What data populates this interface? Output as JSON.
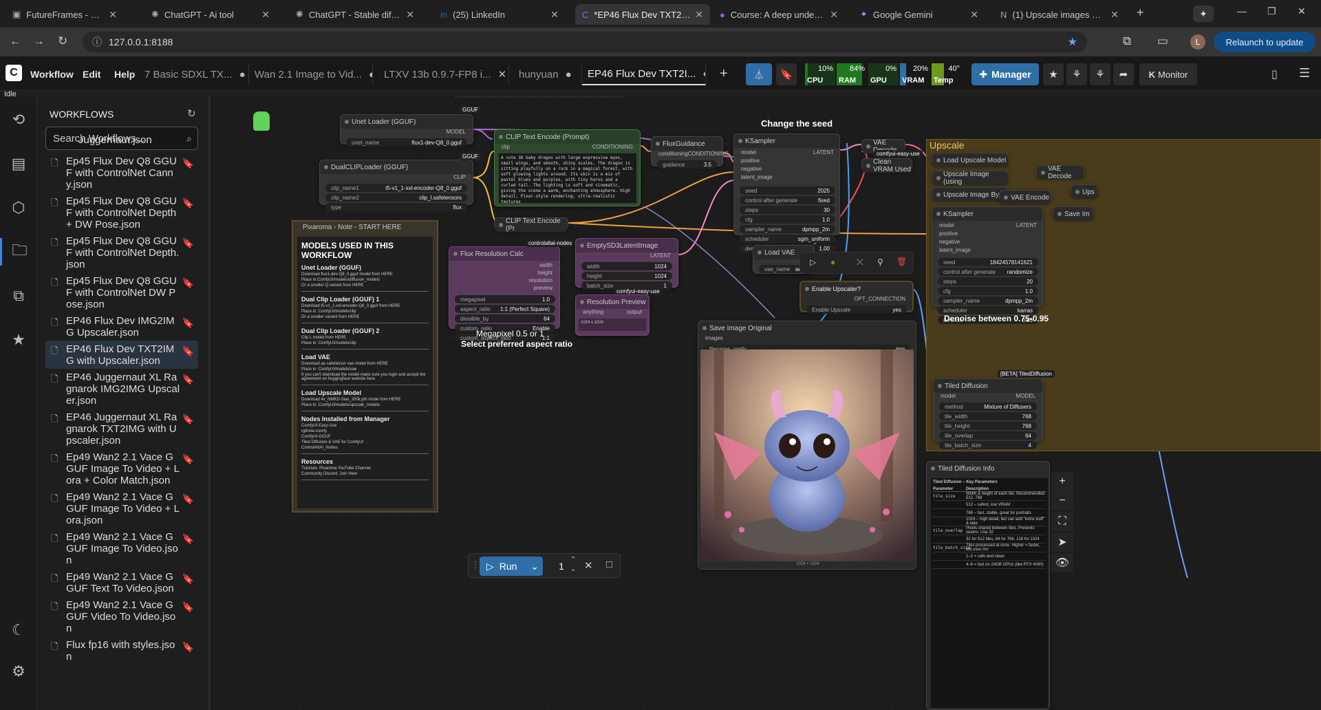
{
  "browser": {
    "tabs": [
      {
        "label": "FutureFrames - Free Wee",
        "icon": "futureframes-icon"
      },
      {
        "label": "ChatGPT - Ai tool",
        "icon": "chatgpt-icon"
      },
      {
        "label": "ChatGPT - Stable diffusio",
        "icon": "chatgpt-icon"
      },
      {
        "label": "(25) LinkedIn",
        "icon": "linkedin-icon"
      },
      {
        "label": "*EP46 Flux Dev TXT2IMG",
        "icon": "comfy-icon"
      },
      {
        "label": "Course: A deep understa",
        "icon": "course-icon"
      },
      {
        "label": "Google Gemini",
        "icon": "gemini-icon"
      },
      {
        "label": "(1) Upscale images worki",
        "icon": "notion-icon"
      }
    ],
    "url": "127.0.0.1:8188",
    "relaunch_label": "Relaunch to update",
    "profile_initial": "L"
  },
  "comfy": {
    "menu": [
      "Workflow",
      "Edit",
      "Help"
    ],
    "workflow_tabs": [
      {
        "label": "7 Basic SDXL TX...",
        "marker": "●"
      },
      {
        "label": "Wan 2.1 Image to Vid...",
        "marker": "●"
      },
      {
        "label": "LTXV 13b 0.9.7-FP8 i...",
        "marker": "✕"
      },
      {
        "label": "hunyuan",
        "marker": "●"
      },
      {
        "label": "EP46 Flux Dev TXT2I...",
        "marker": "●"
      }
    ],
    "add_tab": "+",
    "monitors": [
      {
        "label": "CPU",
        "value": "10%",
        "color": "#1f7a1f"
      },
      {
        "label": "RAM",
        "value": "84%",
        "color": "#1f7a1f"
      },
      {
        "label": "GPU",
        "value": "0%",
        "color": "#1f7a1f"
      },
      {
        "label": "VRAM",
        "value": "20%",
        "color": "#2f6fa8"
      },
      {
        "label": "Temp",
        "value": "40°",
        "color": "#6d9a1a"
      }
    ],
    "manager_label": "Manager",
    "monitor_label": "Monitor",
    "status": "Idle"
  },
  "sidebar": {
    "title": "WORKFLOWS",
    "search_placeholder": "Search Workflows...",
    "partial_top": "Juggernaut.json",
    "items": [
      {
        "name": "Ep45 Flux Dev Q8 GGUF with ControlNet Canny.json",
        "active": false
      },
      {
        "name": "Ep45 Flux Dev Q8 GGUF with ControlNet Depth + DW Pose.json",
        "active": false
      },
      {
        "name": "Ep45 Flux Dev Q8 GGUF with ControlNet Depth.json",
        "active": false
      },
      {
        "name": "Ep45 Flux Dev Q8 GGUF with ControlNet DW Pose.json",
        "active": false
      },
      {
        "name": "EP46 Flux Dev IMG2IMG Upscaler.json",
        "active": false
      },
      {
        "name": "EP46 Flux Dev TXT2IMG with Upscaler.json",
        "active": true
      },
      {
        "name": "EP46 Juggernaut XL Ragnarok IMG2IMG Upscaler.json",
        "active": false
      },
      {
        "name": "EP46 Juggernaut XL Ragnarok TXT2IMG with Upscaler.json",
        "active": false
      },
      {
        "name": "Ep49 Wan2 2.1 Vace GGUF Image To Video + Lora + Color Match.json",
        "active": false
      },
      {
        "name": "Ep49 Wan2 2.1 Vace GGUF Image To Video + Lora.json",
        "active": false
      },
      {
        "name": "Ep49 Wan2 2.1 Vace GGUF Image To Video.json",
        "active": false
      },
      {
        "name": "Ep49 Wan2 2.1 Vace GGUF Text To Video.json",
        "active": false
      },
      {
        "name": "Ep49 Wan2 2.1 Vace GGUF Video To Video.json",
        "active": false
      },
      {
        "name": "Flux fp16 with styles.json",
        "active": false
      }
    ]
  },
  "nodes": {
    "unet": {
      "title": "Unet Loader (GGUF)",
      "badge": "GGUF",
      "out": "MODEL",
      "unet_name_label": "unet_name",
      "unet_name": "flux1-dev-Q8_0.gguf"
    },
    "dualclip": {
      "title": "DualCLIPLoader (GGUF)",
      "badge": "GGUF",
      "out": "CLIP",
      "clip_name1_label": "clip_name1",
      "clip_name1": "t5-v1_1-xxl-encoder-Q8_0.gguf",
      "clip_name2_label": "clip_name2",
      "clip_name2": "clip_l.safetensors",
      "type_label": "type",
      "type": "flux"
    },
    "cliptext": {
      "title": "CLIP Text Encode (Prompt)",
      "in": "clip",
      "out": "CONDITIONING",
      "prompt": "A cute 3D baby dragon with large expressive eyes, small wings, and smooth, shiny scales. The dragon is sitting playfully on a rock in a magical forest, with soft glowing lights around. Its skin is a mix of pastel blues and purples, with tiny horns and a curled tail. The lighting is soft and cinematic, giving the scene a warm, enchanting atmosphere. High detail, Pixar-style rendering, ultra-realistic textures"
    },
    "cliptext2": {
      "title": "CLIP Text Encode (Pr"
    },
    "fluxguidance": {
      "title": "FluxGuidance",
      "in": "conditioning",
      "out": "CONDITIONING",
      "guidance_label": "guidance",
      "guidance": "3.5"
    },
    "ksampler": {
      "title": "KSampler",
      "label_above": "Change the seed",
      "ins": [
        "model",
        "positive",
        "negative",
        "latent_image"
      ],
      "out": "LATENT",
      "params": [
        [
          "seed",
          "2025"
        ],
        [
          "control after generate",
          "fixed"
        ],
        [
          "steps",
          "30"
        ],
        [
          "cfg",
          "1.0"
        ],
        [
          "sampler_name",
          "dpmpp_2m"
        ],
        [
          "scheduler",
          "sgm_uniform"
        ],
        [
          "denoise",
          "1.00"
        ]
      ]
    },
    "vaedecode": {
      "title": "VAE Decode"
    },
    "cleanvram": {
      "title": "Clean VRAM Used",
      "badge": "comfyui-easy-use"
    },
    "loadvae": {
      "title": "Load VAE",
      "vae_name_label": "vae_name",
      "vae_name": "ae."
    },
    "fluxres": {
      "title": "Flux Resolution Calc",
      "badge": "controlaltai-nodes",
      "outs": [
        "width",
        "height",
        "resolution",
        "preview"
      ],
      "params": [
        [
          "megapixel",
          "1.0"
        ],
        [
          "aspect_ratio",
          "1:1 (Perfect Square)"
        ],
        [
          "divisible_by",
          "64"
        ],
        [
          "custom_ratio",
          "Enable"
        ],
        [
          "custom_aspect_ratio",
          "1:1"
        ]
      ],
      "caption_top": "Megapixel 0.5 or 1",
      "caption": "Select preferred aspect ratio"
    },
    "emptylatent": {
      "title": "EmptySD3LatentImage",
      "out": "LATENT",
      "params": [
        [
          "width",
          "1024"
        ],
        [
          "height",
          "1024"
        ],
        [
          "batch_size",
          "1"
        ]
      ]
    },
    "respreview": {
      "title": "Resolution Preview",
      "badge": "comfyui-easy-use",
      "in": "anything",
      "out": "output",
      "value": "1024 x 1024"
    },
    "enableupscaler": {
      "title": "Enable Upscaler?",
      "out": "OPT_CONNECTION",
      "toggle_label": "Enable Upscale",
      "toggle_value": "yes"
    },
    "saveimage": {
      "title": "Save Image Original",
      "in": "images",
      "prefix_label": "filename_prefix",
      "prefix": "img",
      "dims": "1024 × 1024"
    },
    "upscalegroup": {
      "title": "Upscale",
      "load_upscale": "Load Upscale Model",
      "upscale_image_using": "Upscale Image (using",
      "upscale_image_by": "Upscale Image By",
      "vae_encode": "VAE Encode",
      "vae_decode": "VAE Decode",
      "save": "Save Im",
      "ups": "Ups"
    },
    "ksampler2": {
      "title": "KSampler",
      "ins": [
        "model",
        "positive",
        "negative",
        "latent_image"
      ],
      "out": "LATENT",
      "params": [
        [
          "seed",
          "184245781416​21"
        ],
        [
          "control after generate",
          "randomize"
        ],
        [
          "steps",
          "20"
        ],
        [
          "cfg",
          "1.0"
        ],
        [
          "sampler_name",
          "dpmpp_2m"
        ],
        [
          "scheduler",
          "karras"
        ],
        [
          "denoise",
          "0.85"
        ]
      ],
      "caption": "Denoise between 0.75-0.95"
    },
    "tileddiff": {
      "title": "Tiled Diffusion",
      "badge": "[BETA] TiledDiffusion",
      "in": "model",
      "out": "MODEL",
      "params": [
        [
          "method",
          "Mixture of Diffusers"
        ],
        [
          "tile_width",
          "768"
        ],
        [
          "tile_height",
          "768"
        ],
        [
          "tile_overlap",
          "64"
        ],
        [
          "tile_batch_size",
          "4"
        ]
      ]
    },
    "tiledinfo": {
      "title": "Tiled Diffusion Info",
      "heading": "Tiled Diffusion – Key Parameters",
      "cols": [
        "Parameter",
        "Description"
      ],
      "rows": [
        [
          "tile_size",
          "Width & height of each tile. Recommended: 512, 768"
        ],
        [
          "",
          "512 – safest, low VRAM"
        ],
        [
          "",
          "768 – fast, stable, great for portraits"
        ],
        [
          "",
          "1024 – high detail, but can add \"extra stuff\" & take"
        ],
        [
          "tile_overlap",
          "Pixels shared between tiles. Prevents seams. Use 32"
        ],
        [
          "",
          "32 for 512 tiles, 64 for 768, 128 for 1024"
        ],
        [
          "tile_batch_size",
          "Tiles processed at once. Higher = faster, but uses mo"
        ],
        [
          "",
          "1–2 = safe and clean"
        ],
        [
          "",
          "4–6 = fast on 24GB GPUs (like RTX 4090)"
        ]
      ]
    }
  },
  "note": {
    "title": "Pixaroma - Note - START HERE",
    "heading": "MODELS USED IN THIS WORKFLOW",
    "sections": [
      {
        "title": "Unet Loader (GGUF)",
        "lines": [
          "Download flux1-dev-Q8_0.gguf model from HERE",
          "Place in:ComfyUI/models/diffusion_models",
          "Or a smaller Q variant from HERE"
        ]
      },
      {
        "title": "Dual Clip Loader (GGUF) 1",
        "lines": [
          "Download t5-v1_1-xxl-encoder-Q8_0.gguf from HERE",
          "Place in: ComfyUI/models/clip",
          "Or a smaller variant from HERE"
        ]
      },
      {
        "title": "Dual Clip Loader (GGUF) 2",
        "lines": [
          "Clip L model from HERE",
          "Place in: ComfyUI/models/clip"
        ]
      },
      {
        "title": "Load VAE",
        "lines": [
          "Download ae.safetensor vae model from HERE",
          "Place in: ComfyUI/models/vae",
          "If you can't download the model make sure you login and accept the agreement on huggingface website here"
        ]
      },
      {
        "title": "Load Upscale Model",
        "lines": [
          "Download 4x_NMKD-Siax_200k.pth mode from HERE",
          "Place in: ComfyUI/models/upscale_models"
        ]
      },
      {
        "title": "Nodes Installed from Manager",
        "lines": [
          "ComfyUI-Easy-Use",
          "rgthree-comfy",
          "ComfyUI-GGUF",
          "Tiled Diffusion & VAE for ComfyUI",
          "ControlAltAI_Nodes"
        ]
      },
      {
        "title": "Resources",
        "lines": [
          "Tutorials: Pixaroma YouTube Channel",
          "Community Discord: Join Here"
        ]
      }
    ]
  },
  "runbar": {
    "run_label": "Run",
    "queue": "1"
  },
  "colors": {
    "accent": "#2f6fa8",
    "node": "#353535",
    "purple_node": "#5b3a5e",
    "green_node": "#2f4a2f",
    "upscale_group": "#5c4a1c"
  }
}
